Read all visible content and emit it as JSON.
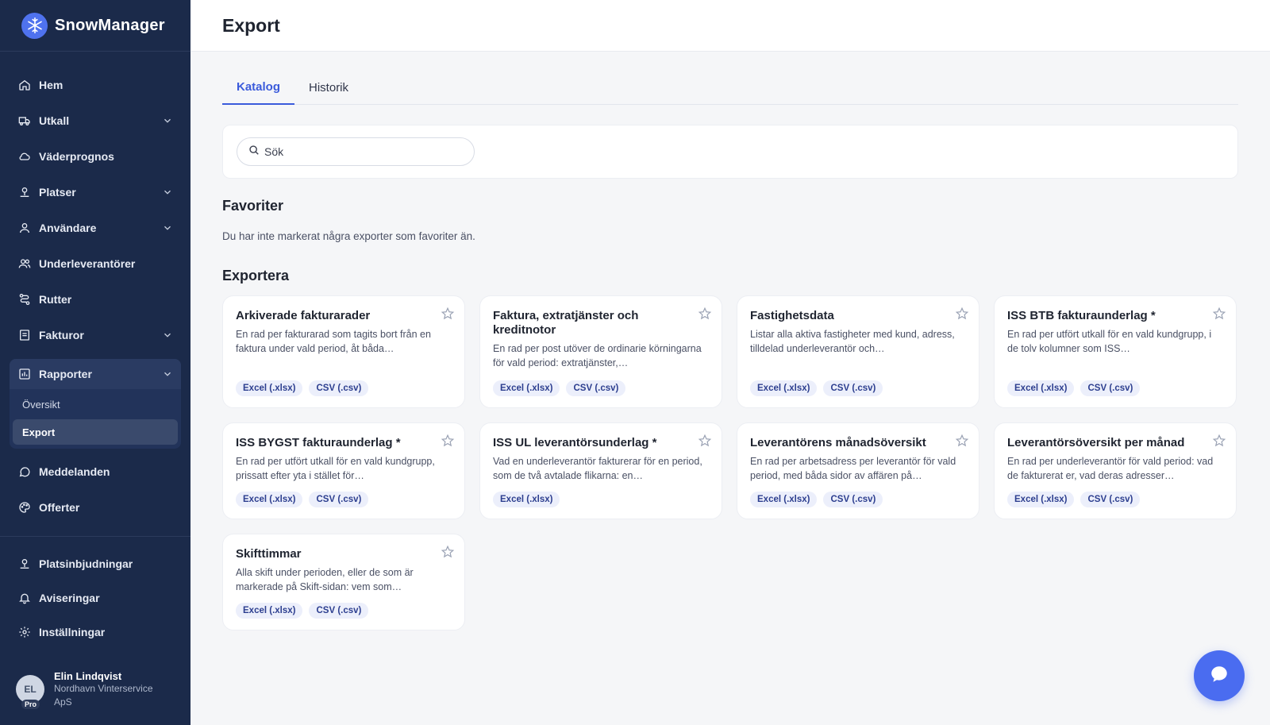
{
  "brand": {
    "name": "SnowManager"
  },
  "nav": {
    "items": [
      {
        "label": "Hem",
        "icon": "home-icon",
        "has_chevron": false
      },
      {
        "label": "Utkall",
        "icon": "truck-icon",
        "has_chevron": true
      },
      {
        "label": "Väderprognos",
        "icon": "cloud-icon",
        "has_chevron": false
      },
      {
        "label": "Platser",
        "icon": "location-icon",
        "has_chevron": true
      },
      {
        "label": "Användare",
        "icon": "user-icon",
        "has_chevron": true
      },
      {
        "label": "Underleverantörer",
        "icon": "users-icon",
        "has_chevron": false
      },
      {
        "label": "Rutter",
        "icon": "route-icon",
        "has_chevron": false
      },
      {
        "label": "Fakturor",
        "icon": "invoice-icon",
        "has_chevron": true
      }
    ],
    "reports": {
      "label": "Rapporter",
      "sub": [
        "Översikt",
        "Export"
      ]
    },
    "after": [
      {
        "label": "Meddelanden",
        "icon": "chat-bubble-icon"
      },
      {
        "label": "Offerter",
        "icon": "palette-icon"
      }
    ],
    "bottom": [
      {
        "label": "Platsinbjudningar",
        "icon": "location-invite-icon"
      },
      {
        "label": "Aviseringar",
        "icon": "bell-icon"
      },
      {
        "label": "Inställningar",
        "icon": "gear-icon"
      }
    ]
  },
  "user": {
    "initials": "EL",
    "badge": "Pro",
    "name": "Elin Lindqvist",
    "org": "Nordhavn Vinterservice ApS"
  },
  "header": {
    "title": "Export"
  },
  "tabs": [
    "Katalog",
    "Historik"
  ],
  "search": {
    "placeholder": "Sök"
  },
  "favorites": {
    "title": "Favoriter",
    "empty": "Du har inte markerat några exporter som favoriter än."
  },
  "exports": {
    "title": "Exportera",
    "cards": [
      {
        "title": "Arkiverade fakturarader",
        "desc": "En rad per fakturarad som tagits bort från en faktura under vald period, åt båda…",
        "formats": [
          "Excel (.xlsx)",
          "CSV (.csv)"
        ]
      },
      {
        "title": "Faktura, extratjänster och kreditnotor",
        "desc": "En rad per post utöver de ordinarie körningarna för vald period: extratjänster,…",
        "formats": [
          "Excel (.xlsx)",
          "CSV (.csv)"
        ]
      },
      {
        "title": "Fastighetsdata",
        "desc": "Listar alla aktiva fastigheter med kund, adress, tilldelad underleverantör och…",
        "formats": [
          "Excel (.xlsx)",
          "CSV (.csv)"
        ]
      },
      {
        "title": "ISS BTB fakturaunderlag *",
        "desc": "En rad per utfört utkall för en vald kundgrupp, i de tolv kolumner som ISS…",
        "formats": [
          "Excel (.xlsx)",
          "CSV (.csv)"
        ]
      },
      {
        "title": "ISS BYGST fakturaunderlag *",
        "desc": "En rad per utfört utkall för en vald kundgrupp, prissatt efter yta i stället för…",
        "formats": [
          "Excel (.xlsx)",
          "CSV (.csv)"
        ]
      },
      {
        "title": "ISS UL leverantörsunderlag *",
        "desc": "Vad en underleverantör fakturerar för en period, som de två avtalade flikarna: en…",
        "formats": [
          "Excel (.xlsx)"
        ]
      },
      {
        "title": "Leverantörens månadsöversikt",
        "desc": "En rad per arbetsadress per leverantör för vald period, med båda sidor av affären på…",
        "formats": [
          "Excel (.xlsx)",
          "CSV (.csv)"
        ]
      },
      {
        "title": "Leverantörsöversikt per månad",
        "desc": "En rad per underleverantör för vald period: vad de fakturerat er, vad deras adresser…",
        "formats": [
          "Excel (.xlsx)",
          "CSV (.csv)"
        ]
      },
      {
        "title": "Skifttimmar",
        "desc": "Alla skift under perioden, eller de som är markerade på Skift-sidan: vem som…",
        "formats": [
          "Excel (.xlsx)",
          "CSV (.csv)"
        ]
      }
    ]
  },
  "colors": {
    "sidebar": "#1b2a4a",
    "accent": "#3b5bdb",
    "chip_bg": "#eceffb",
    "fab": "#4a6cf0"
  }
}
